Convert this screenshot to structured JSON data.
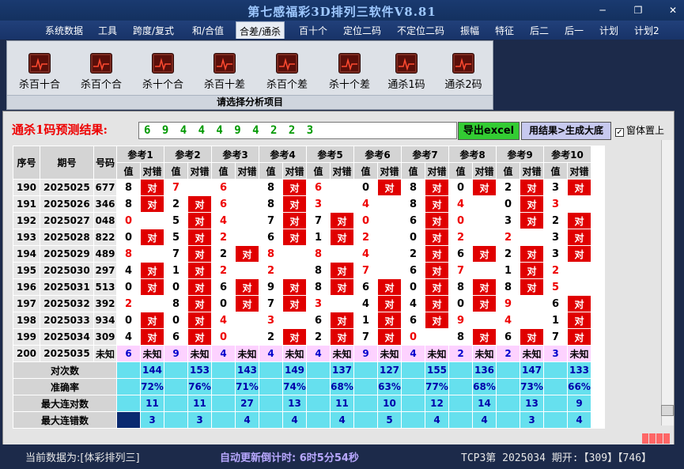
{
  "window": {
    "title": "第七感福彩3D排列三软件V8.81"
  },
  "menu": [
    "系统数据",
    "工具",
    "跨度/复式",
    "和/合值",
    "合差/通杀",
    "百十个",
    "定位二码",
    "不定位二码",
    "振幅",
    "特征",
    "后二",
    "后一",
    "计划",
    "计划2"
  ],
  "menu_active": "合差/通杀",
  "ribbon": {
    "buttons": [
      "杀百十合",
      "杀百个合",
      "杀十个合",
      "杀百十差",
      "杀百个差",
      "杀十个差",
      "通杀1码",
      "通杀2码"
    ],
    "caption": "请选择分析项目"
  },
  "prediction": {
    "label": "通杀1码预测结果:",
    "value": "6 9 4 4 4 9 4 2 2 3",
    "export_btn": "导出excel",
    "generate_btn": "用结果>生成大底",
    "ontop_label": "窗体置上",
    "ontop_checked": "✓"
  },
  "table": {
    "headers": {
      "seq": "序号",
      "period": "期号",
      "code": "号码",
      "val": "值",
      "duiCuo": "对错",
      "refs": [
        "参考1",
        "参考2",
        "参考3",
        "参考4",
        "参考5",
        "参考6",
        "参考7",
        "参考8",
        "参考9",
        "参考10"
      ]
    },
    "rows": [
      {
        "seq": "190",
        "period": "2025025",
        "code": "677",
        "cells": [
          [
            "8",
            1
          ],
          [
            "7",
            0
          ],
          [
            "6",
            0
          ],
          [
            "8",
            1
          ],
          [
            "6",
            0
          ],
          [
            "0",
            1
          ],
          [
            "8",
            1
          ],
          [
            "0",
            1
          ],
          [
            "2",
            1
          ],
          [
            "3",
            1
          ]
        ]
      },
      {
        "seq": "191",
        "period": "2025026",
        "code": "346",
        "cells": [
          [
            "8",
            1
          ],
          [
            "2",
            1
          ],
          [
            "6",
            0
          ],
          [
            "8",
            1
          ],
          [
            "3",
            0
          ],
          [
            "4",
            0
          ],
          [
            "8",
            1
          ],
          [
            "4",
            0
          ],
          [
            "0",
            1
          ],
          [
            "3",
            0
          ]
        ]
      },
      {
        "seq": "192",
        "period": "2025027",
        "code": "048",
        "cells": [
          [
            "0",
            0
          ],
          [
            "5",
            1
          ],
          [
            "4",
            0
          ],
          [
            "7",
            1
          ],
          [
            "7",
            1
          ],
          [
            "0",
            0
          ],
          [
            "6",
            1
          ],
          [
            "0",
            0
          ],
          [
            "3",
            1
          ],
          [
            "2",
            1
          ]
        ]
      },
      {
        "seq": "193",
        "period": "2025028",
        "code": "822",
        "cells": [
          [
            "0",
            1
          ],
          [
            "5",
            1
          ],
          [
            "2",
            0
          ],
          [
            "6",
            1
          ],
          [
            "1",
            1
          ],
          [
            "2",
            0
          ],
          [
            "0",
            1
          ],
          [
            "2",
            0
          ],
          [
            "2",
            0
          ],
          [
            "3",
            1
          ]
        ]
      },
      {
        "seq": "194",
        "period": "2025029",
        "code": "489",
        "cells": [
          [
            "8",
            0
          ],
          [
            "7",
            1
          ],
          [
            "2",
            1
          ],
          [
            "8",
            0
          ],
          [
            "8",
            0
          ],
          [
            "4",
            0
          ],
          [
            "2",
            1
          ],
          [
            "6",
            1
          ],
          [
            "2",
            1
          ],
          [
            "3",
            1
          ]
        ]
      },
      {
        "seq": "195",
        "period": "2025030",
        "code": "297",
        "cells": [
          [
            "4",
            1
          ],
          [
            "1",
            1
          ],
          [
            "2",
            0
          ],
          [
            "2",
            0
          ],
          [
            "8",
            1
          ],
          [
            "7",
            0
          ],
          [
            "6",
            1
          ],
          [
            "7",
            0
          ],
          [
            "1",
            1
          ],
          [
            "2",
            0
          ]
        ]
      },
      {
        "seq": "196",
        "period": "2025031",
        "code": "513",
        "cells": [
          [
            "0",
            1
          ],
          [
            "0",
            1
          ],
          [
            "6",
            1
          ],
          [
            "9",
            1
          ],
          [
            "8",
            1
          ],
          [
            "6",
            1
          ],
          [
            "0",
            1
          ],
          [
            "8",
            1
          ],
          [
            "8",
            1
          ],
          [
            "5",
            0
          ]
        ]
      },
      {
        "seq": "197",
        "period": "2025032",
        "code": "392",
        "cells": [
          [
            "2",
            0
          ],
          [
            "8",
            1
          ],
          [
            "0",
            1
          ],
          [
            "7",
            1
          ],
          [
            "3",
            0
          ],
          [
            "4",
            1
          ],
          [
            "4",
            1
          ],
          [
            "0",
            1
          ],
          [
            "9",
            0
          ],
          [
            "6",
            1
          ]
        ]
      },
      {
        "seq": "198",
        "period": "2025033",
        "code": "934",
        "cells": [
          [
            "0",
            1
          ],
          [
            "0",
            1
          ],
          [
            "4",
            0
          ],
          [
            "3",
            0
          ],
          [
            "6",
            1
          ],
          [
            "1",
            1
          ],
          [
            "6",
            1
          ],
          [
            "9",
            0
          ],
          [
            "4",
            0
          ],
          [
            "1",
            1
          ]
        ]
      },
      {
        "seq": "199",
        "period": "2025034",
        "code": "309",
        "cells": [
          [
            "4",
            1
          ],
          [
            "6",
            1
          ],
          [
            "0",
            0
          ],
          [
            "2",
            1
          ],
          [
            "2",
            1
          ],
          [
            "7",
            1
          ],
          [
            "0",
            0
          ],
          [
            "8",
            1
          ],
          [
            "6",
            1
          ],
          [
            "7",
            1
          ]
        ]
      }
    ],
    "pending": {
      "seq": "200",
      "period": "2025035",
      "code": "未知",
      "vals": [
        "6",
        "9",
        "4",
        "4",
        "4",
        "9",
        "4",
        "2",
        "2",
        "3"
      ],
      "status": "未知"
    },
    "stats": [
      {
        "label": "对次数",
        "values": [
          "144",
          "153",
          "143",
          "149",
          "137",
          "127",
          "155",
          "136",
          "147",
          "133"
        ]
      },
      {
        "label": "准确率",
        "values": [
          "72%",
          "76%",
          "71%",
          "74%",
          "68%",
          "63%",
          "77%",
          "68%",
          "73%",
          "66%"
        ]
      },
      {
        "label": "最大连对数",
        "values": [
          "11",
          "11",
          "27",
          "13",
          "11",
          "10",
          "12",
          "14",
          "13",
          "9"
        ]
      },
      {
        "label": "最大连错数",
        "values": [
          "3",
          "3",
          "4",
          "4",
          "4",
          "5",
          "4",
          "4",
          "3",
          "4"
        ]
      }
    ]
  },
  "status": {
    "left": "当前数据为:[体彩排列三]",
    "mid": "自动更新倒计时: 6时5分54秒",
    "right": "TCP3第 2025034 期开:【309】【746】"
  },
  "colors": {
    "correct_red": "#e00000",
    "stat_cyan": "#66e0ee",
    "pending_pink": "#fdd2ff",
    "export_green": "#33cc33",
    "gen_purple": "#c7c9ef",
    "frame_navy": "#1c2a4a"
  }
}
